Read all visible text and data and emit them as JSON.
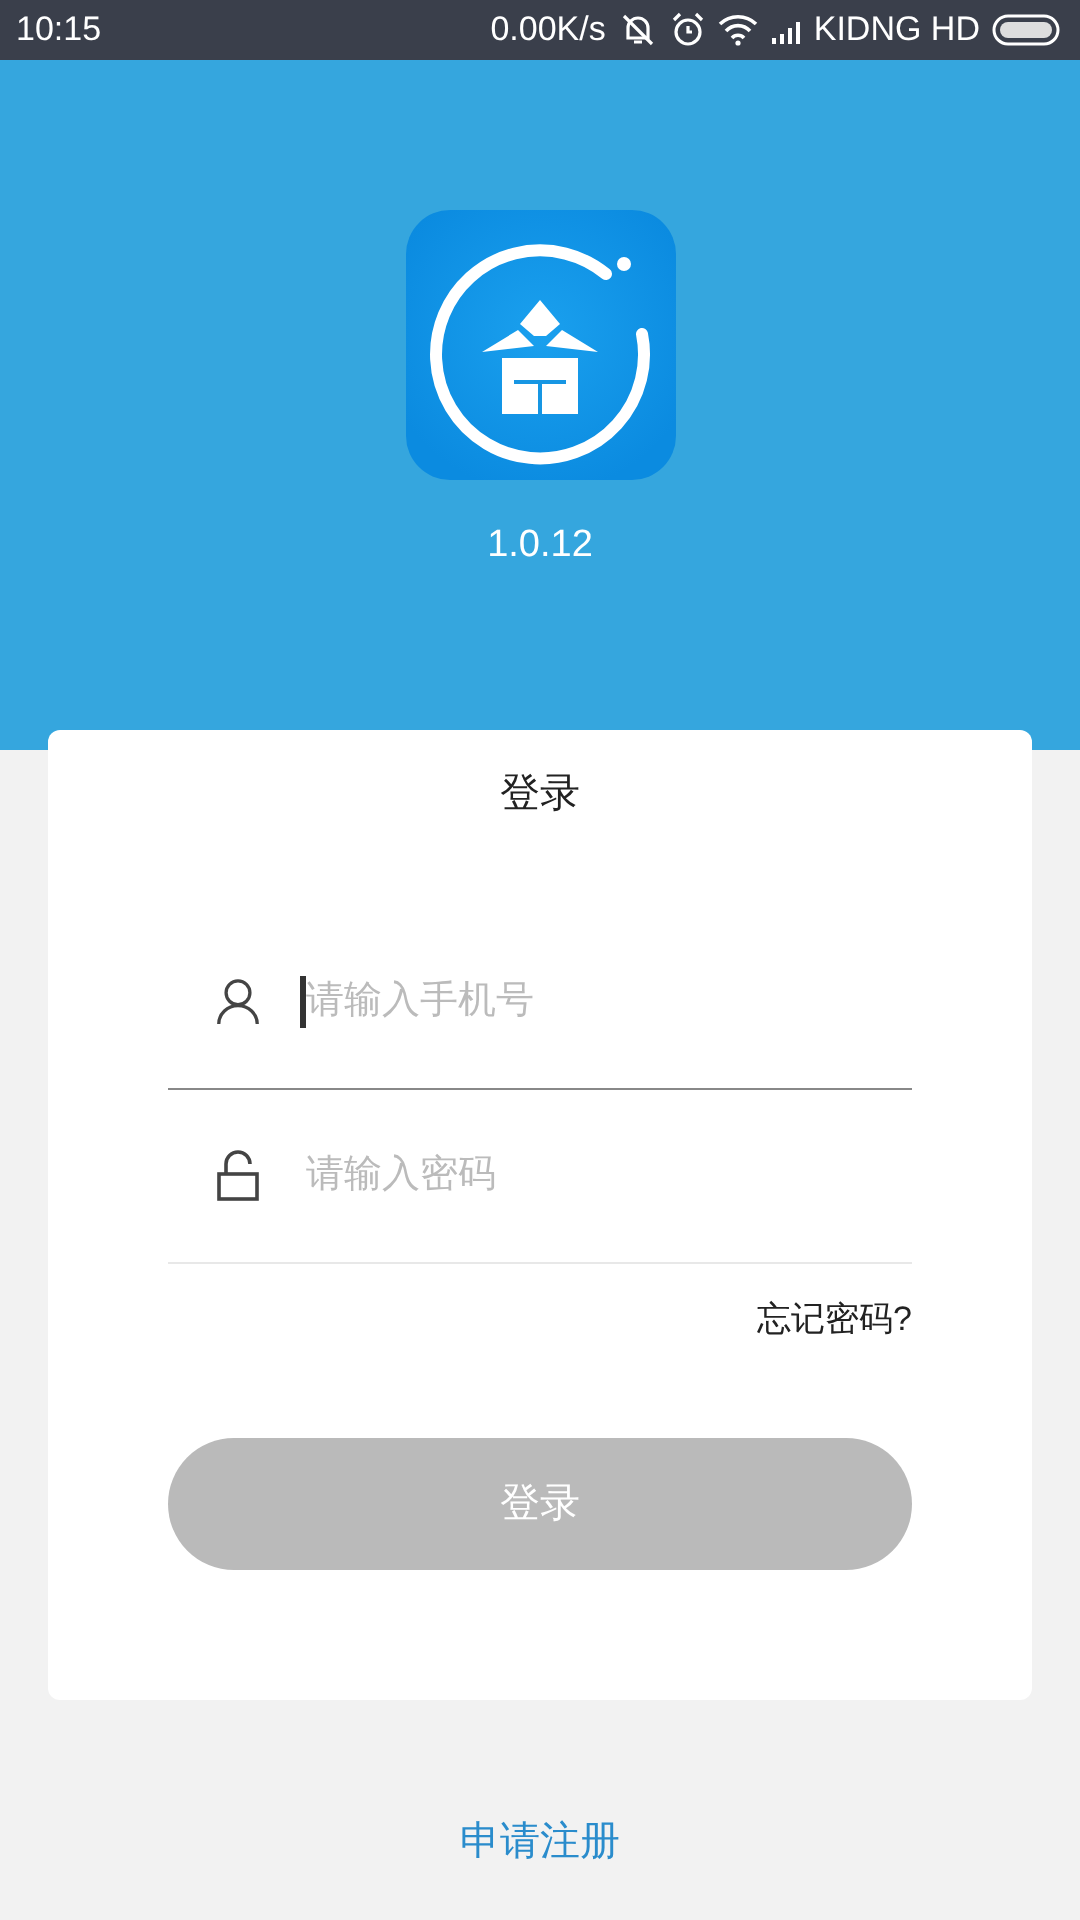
{
  "status_bar": {
    "time": "10:15",
    "speed": "0.00K/s",
    "carrier": "KIDNG HD"
  },
  "app": {
    "version": "1.0.12"
  },
  "login_card": {
    "title": "登录",
    "fields": [
      {
        "kind": "phone",
        "placeholder": "请输入手机号",
        "focused": true
      },
      {
        "kind": "password",
        "placeholder": "请输入密码",
        "focused": false
      }
    ],
    "forgot_link": "忘记密码?",
    "submit": {
      "label": "登录",
      "disabled": true
    }
  },
  "register_link": "申请注册"
}
